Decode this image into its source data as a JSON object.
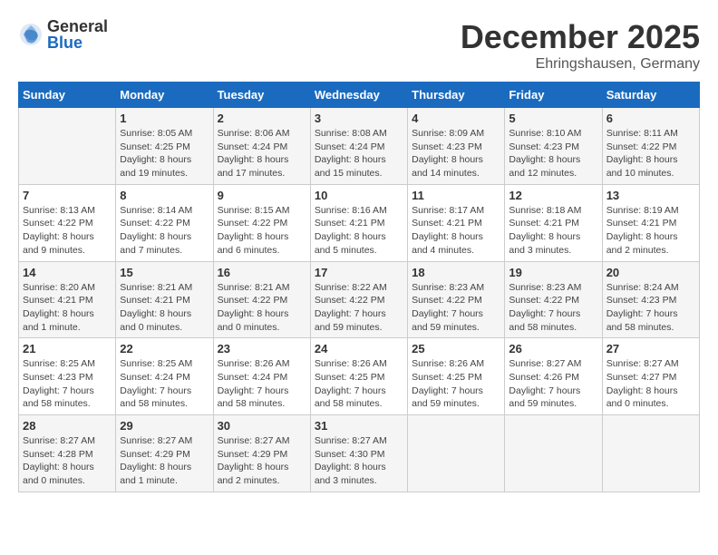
{
  "header": {
    "logo_general": "General",
    "logo_blue": "Blue",
    "month_year": "December 2025",
    "location": "Ehringshausen, Germany"
  },
  "days_of_week": [
    "Sunday",
    "Monday",
    "Tuesday",
    "Wednesday",
    "Thursday",
    "Friday",
    "Saturday"
  ],
  "weeks": [
    [
      {
        "day": "",
        "info": ""
      },
      {
        "day": "1",
        "info": "Sunrise: 8:05 AM\nSunset: 4:25 PM\nDaylight: 8 hours\nand 19 minutes."
      },
      {
        "day": "2",
        "info": "Sunrise: 8:06 AM\nSunset: 4:24 PM\nDaylight: 8 hours\nand 17 minutes."
      },
      {
        "day": "3",
        "info": "Sunrise: 8:08 AM\nSunset: 4:24 PM\nDaylight: 8 hours\nand 15 minutes."
      },
      {
        "day": "4",
        "info": "Sunrise: 8:09 AM\nSunset: 4:23 PM\nDaylight: 8 hours\nand 14 minutes."
      },
      {
        "day": "5",
        "info": "Sunrise: 8:10 AM\nSunset: 4:23 PM\nDaylight: 8 hours\nand 12 minutes."
      },
      {
        "day": "6",
        "info": "Sunrise: 8:11 AM\nSunset: 4:22 PM\nDaylight: 8 hours\nand 10 minutes."
      }
    ],
    [
      {
        "day": "7",
        "info": "Sunrise: 8:13 AM\nSunset: 4:22 PM\nDaylight: 8 hours\nand 9 minutes."
      },
      {
        "day": "8",
        "info": "Sunrise: 8:14 AM\nSunset: 4:22 PM\nDaylight: 8 hours\nand 7 minutes."
      },
      {
        "day": "9",
        "info": "Sunrise: 8:15 AM\nSunset: 4:22 PM\nDaylight: 8 hours\nand 6 minutes."
      },
      {
        "day": "10",
        "info": "Sunrise: 8:16 AM\nSunset: 4:21 PM\nDaylight: 8 hours\nand 5 minutes."
      },
      {
        "day": "11",
        "info": "Sunrise: 8:17 AM\nSunset: 4:21 PM\nDaylight: 8 hours\nand 4 minutes."
      },
      {
        "day": "12",
        "info": "Sunrise: 8:18 AM\nSunset: 4:21 PM\nDaylight: 8 hours\nand 3 minutes."
      },
      {
        "day": "13",
        "info": "Sunrise: 8:19 AM\nSunset: 4:21 PM\nDaylight: 8 hours\nand 2 minutes."
      }
    ],
    [
      {
        "day": "14",
        "info": "Sunrise: 8:20 AM\nSunset: 4:21 PM\nDaylight: 8 hours\nand 1 minute."
      },
      {
        "day": "15",
        "info": "Sunrise: 8:21 AM\nSunset: 4:21 PM\nDaylight: 8 hours\nand 0 minutes."
      },
      {
        "day": "16",
        "info": "Sunrise: 8:21 AM\nSunset: 4:22 PM\nDaylight: 8 hours\nand 0 minutes."
      },
      {
        "day": "17",
        "info": "Sunrise: 8:22 AM\nSunset: 4:22 PM\nDaylight: 7 hours\nand 59 minutes."
      },
      {
        "day": "18",
        "info": "Sunrise: 8:23 AM\nSunset: 4:22 PM\nDaylight: 7 hours\nand 59 minutes."
      },
      {
        "day": "19",
        "info": "Sunrise: 8:23 AM\nSunset: 4:22 PM\nDaylight: 7 hours\nand 58 minutes."
      },
      {
        "day": "20",
        "info": "Sunrise: 8:24 AM\nSunset: 4:23 PM\nDaylight: 7 hours\nand 58 minutes."
      }
    ],
    [
      {
        "day": "21",
        "info": "Sunrise: 8:25 AM\nSunset: 4:23 PM\nDaylight: 7 hours\nand 58 minutes."
      },
      {
        "day": "22",
        "info": "Sunrise: 8:25 AM\nSunset: 4:24 PM\nDaylight: 7 hours\nand 58 minutes."
      },
      {
        "day": "23",
        "info": "Sunrise: 8:26 AM\nSunset: 4:24 PM\nDaylight: 7 hours\nand 58 minutes."
      },
      {
        "day": "24",
        "info": "Sunrise: 8:26 AM\nSunset: 4:25 PM\nDaylight: 7 hours\nand 58 minutes."
      },
      {
        "day": "25",
        "info": "Sunrise: 8:26 AM\nSunset: 4:25 PM\nDaylight: 7 hours\nand 59 minutes."
      },
      {
        "day": "26",
        "info": "Sunrise: 8:27 AM\nSunset: 4:26 PM\nDaylight: 7 hours\nand 59 minutes."
      },
      {
        "day": "27",
        "info": "Sunrise: 8:27 AM\nSunset: 4:27 PM\nDaylight: 8 hours\nand 0 minutes."
      }
    ],
    [
      {
        "day": "28",
        "info": "Sunrise: 8:27 AM\nSunset: 4:28 PM\nDaylight: 8 hours\nand 0 minutes."
      },
      {
        "day": "29",
        "info": "Sunrise: 8:27 AM\nSunset: 4:29 PM\nDaylight: 8 hours\nand 1 minute."
      },
      {
        "day": "30",
        "info": "Sunrise: 8:27 AM\nSunset: 4:29 PM\nDaylight: 8 hours\nand 2 minutes."
      },
      {
        "day": "31",
        "info": "Sunrise: 8:27 AM\nSunset: 4:30 PM\nDaylight: 8 hours\nand 3 minutes."
      },
      {
        "day": "",
        "info": ""
      },
      {
        "day": "",
        "info": ""
      },
      {
        "day": "",
        "info": ""
      }
    ]
  ]
}
